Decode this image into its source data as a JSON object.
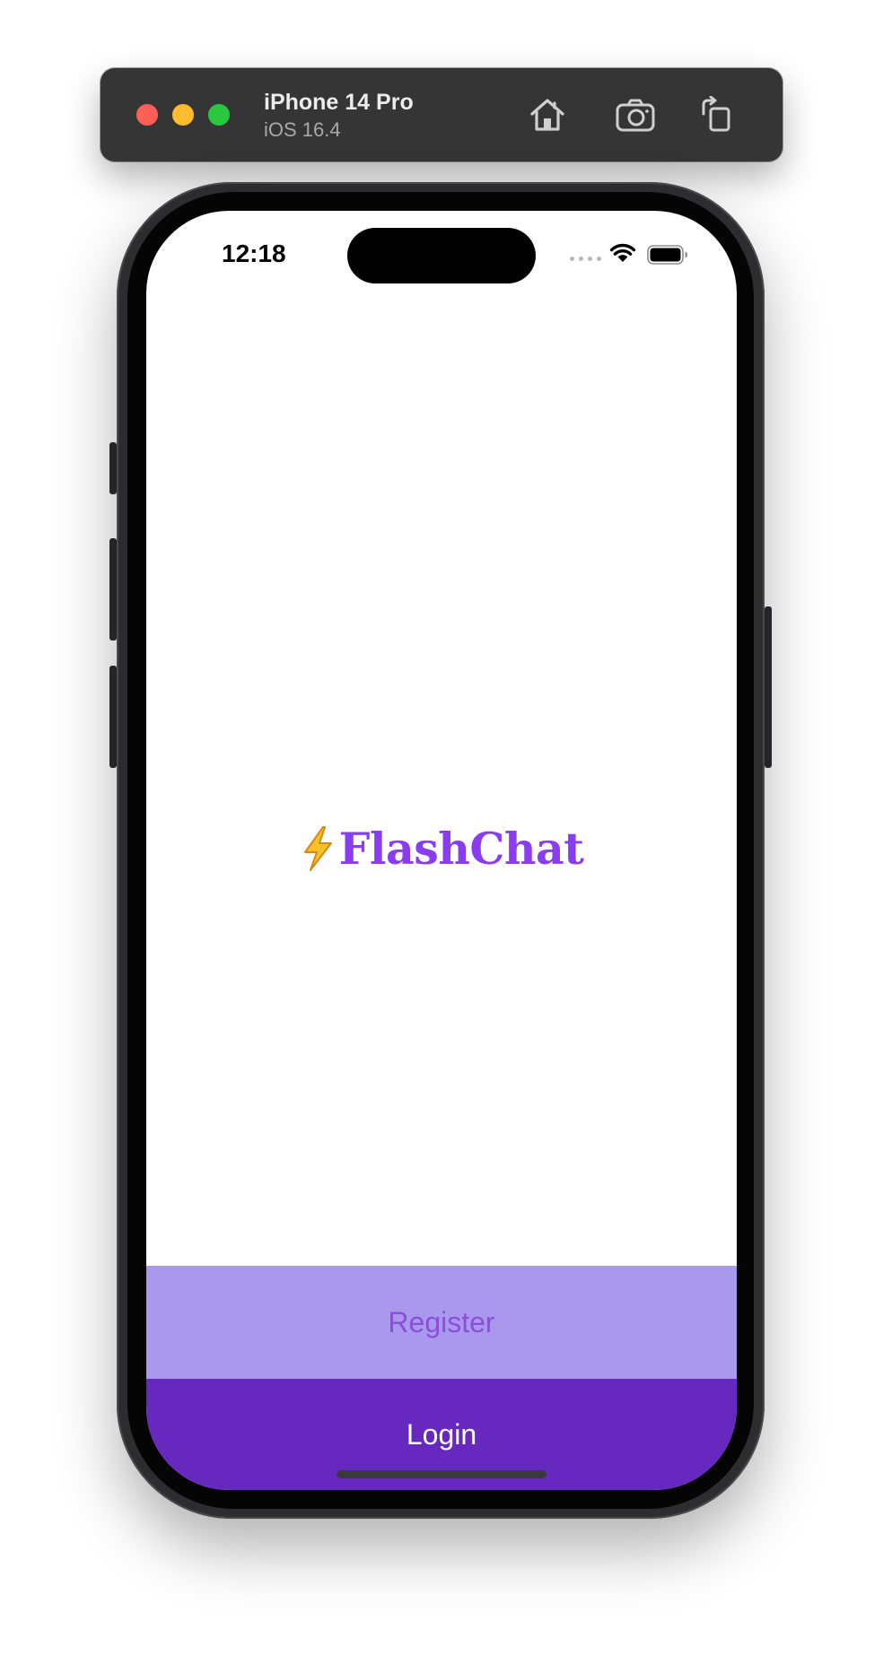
{
  "simulator": {
    "device_name": "iPhone 14 Pro",
    "os_version": "iOS 16.4",
    "toolbar_icons": [
      "home-icon",
      "screenshot-icon",
      "rotate-icon"
    ]
  },
  "status_bar": {
    "time": "12:18",
    "icons": [
      "cellular-signal-icon",
      "wifi-icon",
      "battery-icon"
    ]
  },
  "app": {
    "logo_emoji": "⚡",
    "logo_title": "FlashChat",
    "register_label": "Register",
    "login_label": "Login"
  },
  "colors": {
    "brand_purple": "#8a3cf0",
    "register_bg": "#aa98ee",
    "register_text": "#8a4fd6",
    "login_bg": "#6628bf",
    "login_text": "#ffffff",
    "bolt_yellow": "#f5c02c"
  }
}
